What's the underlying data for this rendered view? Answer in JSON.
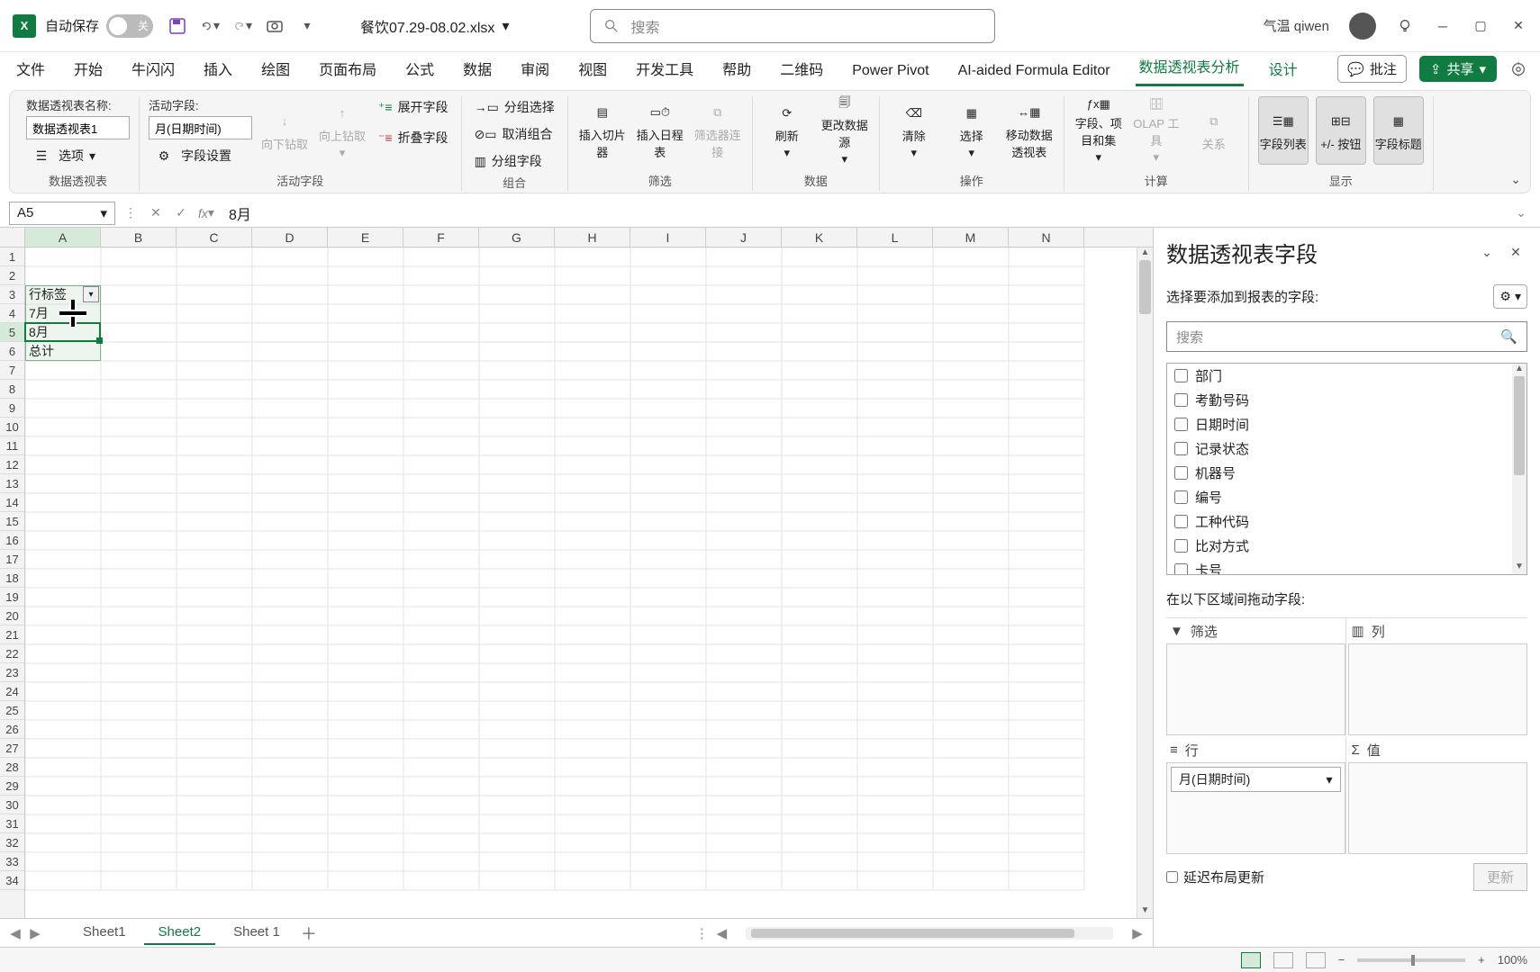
{
  "titlebar": {
    "autosave_label": "自动保存",
    "autosave_state": "关",
    "filename": "餐饮07.29-08.02.xlsx",
    "search_placeholder": "搜索",
    "weather": "气温 qiwen"
  },
  "tabs": {
    "items": [
      "文件",
      "开始",
      "牛闪闪",
      "插入",
      "绘图",
      "页面布局",
      "公式",
      "数据",
      "审阅",
      "视图",
      "开发工具",
      "帮助",
      "二维码",
      "Power Pivot",
      "AI-aided Formula Editor",
      "数据透视表分析",
      "设计"
    ],
    "active_index": 15,
    "comment_label": "批注",
    "share_label": "共享"
  },
  "ribbon": {
    "pivot_table": {
      "name_label": "数据透视表名称:",
      "name_value": "数据透视表1",
      "options_label": "选项",
      "group_label": "数据透视表"
    },
    "active_field": {
      "label": "活动字段:",
      "value": "月(日期时间)",
      "settings_label": "字段设置",
      "drilldown": "向下钻取",
      "drillup": "向上钻取",
      "expand": "展开字段",
      "collapse": "折叠字段",
      "group_label": "活动字段"
    },
    "group": {
      "group_sel": "分组选择",
      "ungroup": "取消组合",
      "group_field": "分组字段",
      "group_label": "组合"
    },
    "filter": {
      "slicer": "插入切片器",
      "timeline": "插入日程表",
      "connections": "筛选器连接",
      "group_label": "筛选"
    },
    "data": {
      "refresh": "刷新",
      "change_source": "更改数据源",
      "group_label": "数据"
    },
    "actions": {
      "clear": "清除",
      "select": "选择",
      "move": "移动数据透视表",
      "group_label": "操作"
    },
    "calc": {
      "fields": "字段、项目和集",
      "olap": "OLAP 工具",
      "relations": "关系",
      "group_label": "计算"
    },
    "show": {
      "fieldlist": "字段列表",
      "buttons": "+/- 按钮",
      "headers": "字段标题",
      "group_label": "显示"
    }
  },
  "formula_bar": {
    "name_box": "A5",
    "formula": "8月"
  },
  "grid": {
    "columns": [
      "A",
      "B",
      "C",
      "D",
      "E",
      "F",
      "G",
      "H",
      "I",
      "J",
      "K",
      "L",
      "M",
      "N"
    ],
    "rows_count": 34,
    "cells": {
      "A3": "行标签",
      "A4": "7月",
      "A5": "8月",
      "A6": "总计"
    },
    "active_cell": "A5"
  },
  "sheets": {
    "items": [
      "Sheet1",
      "Sheet2",
      "Sheet 1"
    ],
    "active_index": 1
  },
  "taskpane": {
    "title": "数据透视表字段",
    "choose_label": "选择要添加到报表的字段:",
    "search_placeholder": "搜索",
    "fields": [
      "部门",
      "考勤号码",
      "日期时间",
      "记录状态",
      "机器号",
      "编号",
      "工种代码",
      "比对方式",
      "卡号"
    ],
    "areas_label": "在以下区域间拖动字段:",
    "filter_label": "筛选",
    "columns_label": "列",
    "rows_label": "行",
    "values_label": "值",
    "row_field": "月(日期时间)",
    "defer_label": "延迟布局更新",
    "update_label": "更新"
  },
  "statusbar": {
    "zoom": "100%"
  }
}
